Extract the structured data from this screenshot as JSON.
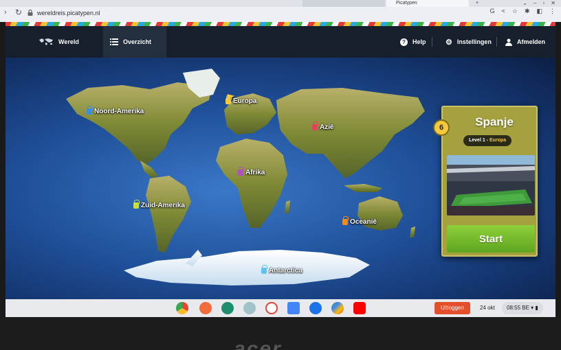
{
  "browser": {
    "url": "wereldreis.picatypen.nl",
    "tab_text": "Picatypen"
  },
  "app": {
    "nav": {
      "wereld": "Wereld",
      "overzicht": "Overzicht",
      "help": "Help",
      "instellingen": "Instellingen",
      "afmelden": "Afmelden"
    },
    "regions": [
      {
        "name": "Noord-Amerika",
        "lock_color": "#3b8ee8"
      },
      {
        "name": "Europa",
        "lock_color": "#f5c93a"
      },
      {
        "name": "Azië",
        "lock_color": "#e0455e"
      },
      {
        "name": "Afrika",
        "lock_color": "#b24fc0"
      },
      {
        "name": "Zuid-Amerika",
        "lock_color": "#c9e03a"
      },
      {
        "name": "Oceanië",
        "lock_color": "#f28a1e"
      },
      {
        "name": "Antarctica",
        "lock_color": "#5ec3f0"
      }
    ],
    "level_card": {
      "number": "6",
      "title": "Spanje",
      "level_prefix": "Level 1 - ",
      "level_region": "Europa",
      "start_label": "Start"
    }
  },
  "shelf": {
    "logout": "Uitloggen",
    "date": "24 okt",
    "time": "08:55 BE"
  },
  "bezel": {
    "logo": "acer"
  },
  "colors": {
    "nav_bg": "#16202c",
    "ocean": "#1f4f98",
    "card": "#a4a13e",
    "start": "#6fb82a",
    "logout": "#e24f2a"
  }
}
